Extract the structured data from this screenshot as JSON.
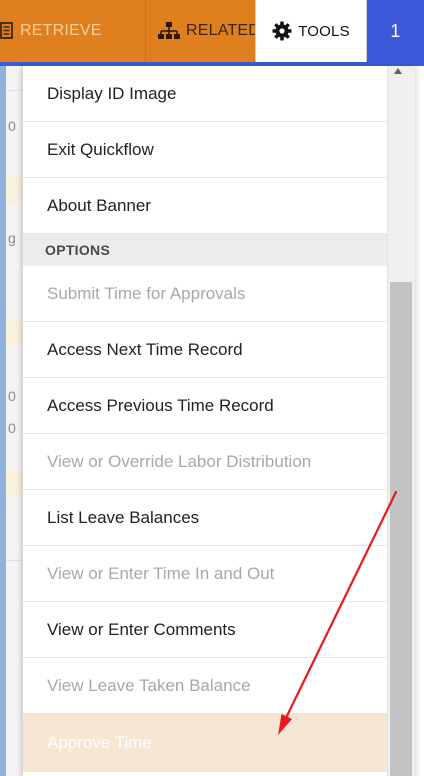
{
  "toolbar": {
    "retrieve_label": "RETRIEVE",
    "related_label": "RELATED",
    "tools_label": "TOOLS",
    "count": "1"
  },
  "background": {
    "fragments": [
      "0",
      "g",
      "0",
      "0"
    ]
  },
  "menu": {
    "items_top": [
      {
        "label": "Display ID Image",
        "enabled": true
      },
      {
        "label": "Exit Quickflow",
        "enabled": true
      },
      {
        "label": "About Banner",
        "enabled": true
      }
    ],
    "options_header": "OPTIONS",
    "items_options": [
      {
        "label": "Submit Time for Approvals",
        "enabled": false
      },
      {
        "label": "Access Next Time Record",
        "enabled": true
      },
      {
        "label": "Access Previous Time Record",
        "enabled": true
      },
      {
        "label": "View or Override Labor Distribution",
        "enabled": false
      },
      {
        "label": "List Leave Balances",
        "enabled": true
      },
      {
        "label": "View or Enter Time In and Out",
        "enabled": false
      },
      {
        "label": "View or Enter Comments",
        "enabled": true
      },
      {
        "label": "View Leave Taken Balance",
        "enabled": false
      },
      {
        "label": "Approve Time",
        "enabled": true,
        "highlighted": true
      }
    ]
  },
  "colors": {
    "toolbar_orange": "#e07f1e",
    "accent_blue": "#3b59d9",
    "highlight_row": "#f7e6d4",
    "disabled_text": "#a8a8a8",
    "annotation_arrow": "#e8191c"
  },
  "icons": {
    "retrieve": "document-icon",
    "related": "sitemap-icon",
    "tools": "gear-icon"
  }
}
